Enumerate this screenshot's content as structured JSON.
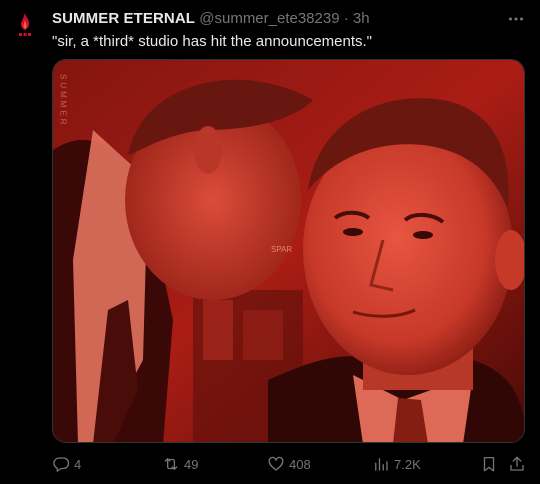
{
  "tweet": {
    "author_name": "SUMMER ETERNAL",
    "handle": "@summer_ete38239",
    "separator": "·",
    "time": "3h",
    "text": "\"sir, a *third* studio has hit the announcements.\"",
    "media": {
      "watermark_vertical": "SUMMER",
      "watermark_small": "SPAR",
      "tint_color": "#c0392b"
    }
  },
  "actions": {
    "replies": "4",
    "reposts": "49",
    "likes": "408",
    "views": "7.2K"
  },
  "colors": {
    "background": "#000000",
    "text_primary": "#e7e9ea",
    "text_secondary": "#71767b",
    "border": "#2f3336",
    "avatar_accent": "#c8102e"
  }
}
